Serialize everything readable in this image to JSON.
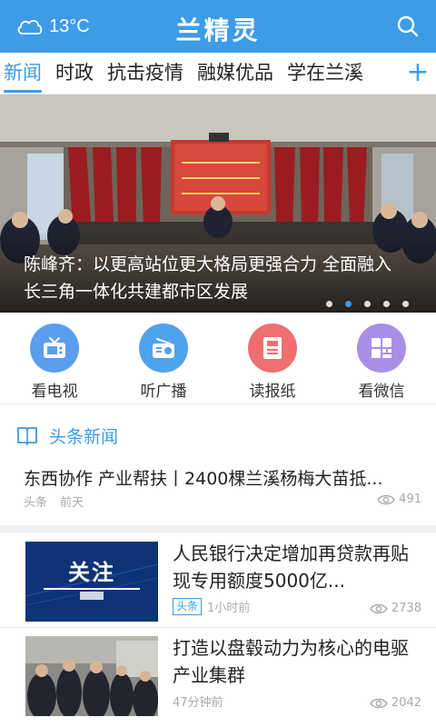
{
  "header": {
    "temperature": "13°C",
    "weather_icon": "cloud-icon",
    "title": "兰精灵",
    "search_icon": "search-icon"
  },
  "tabs": {
    "items": [
      {
        "label": "新闻",
        "active": true
      },
      {
        "label": "时政",
        "active": false
      },
      {
        "label": "抗击疫情",
        "active": false
      },
      {
        "label": "融媒优品",
        "active": false
      },
      {
        "label": "学在兰溪",
        "active": false
      }
    ],
    "add_label": "+"
  },
  "banner": {
    "caption": "陈峰齐：以更高站位更大格局更强合力 全面融入长三角一体化共建都市区发展",
    "slide_count": 5,
    "active_index": 1
  },
  "quick_access": [
    {
      "label": "看电视",
      "icon": "tv-icon",
      "color": "#5b9ef0"
    },
    {
      "label": "听广播",
      "icon": "radio-icon",
      "color": "#4fa3ee"
    },
    {
      "label": "读报纸",
      "icon": "newspaper-icon",
      "color": "#ef6f6f"
    },
    {
      "label": "看微信",
      "icon": "wechat-grid-icon",
      "color": "#a98ee8"
    }
  ],
  "section": {
    "title": "头条新闻",
    "icon": "book-icon"
  },
  "lead_news": {
    "title": "东西协作 产业帮扶丨2400棵兰溪杨梅大苗抵...",
    "category": "头条",
    "time": "前天",
    "views": "491"
  },
  "news": [
    {
      "title": "人民银行决定增加再贷款再贴现专用额度5000亿...",
      "tag": "头条",
      "time": "1小时前",
      "views": "2738",
      "thumb_text": "关注"
    },
    {
      "title": "打造以盘毂动力为核心的电驱产业集群",
      "tag": "",
      "time": "47分钟前",
      "views": "2042"
    }
  ],
  "colors": {
    "accent": "#3d9be8",
    "divider": "#ececec"
  }
}
